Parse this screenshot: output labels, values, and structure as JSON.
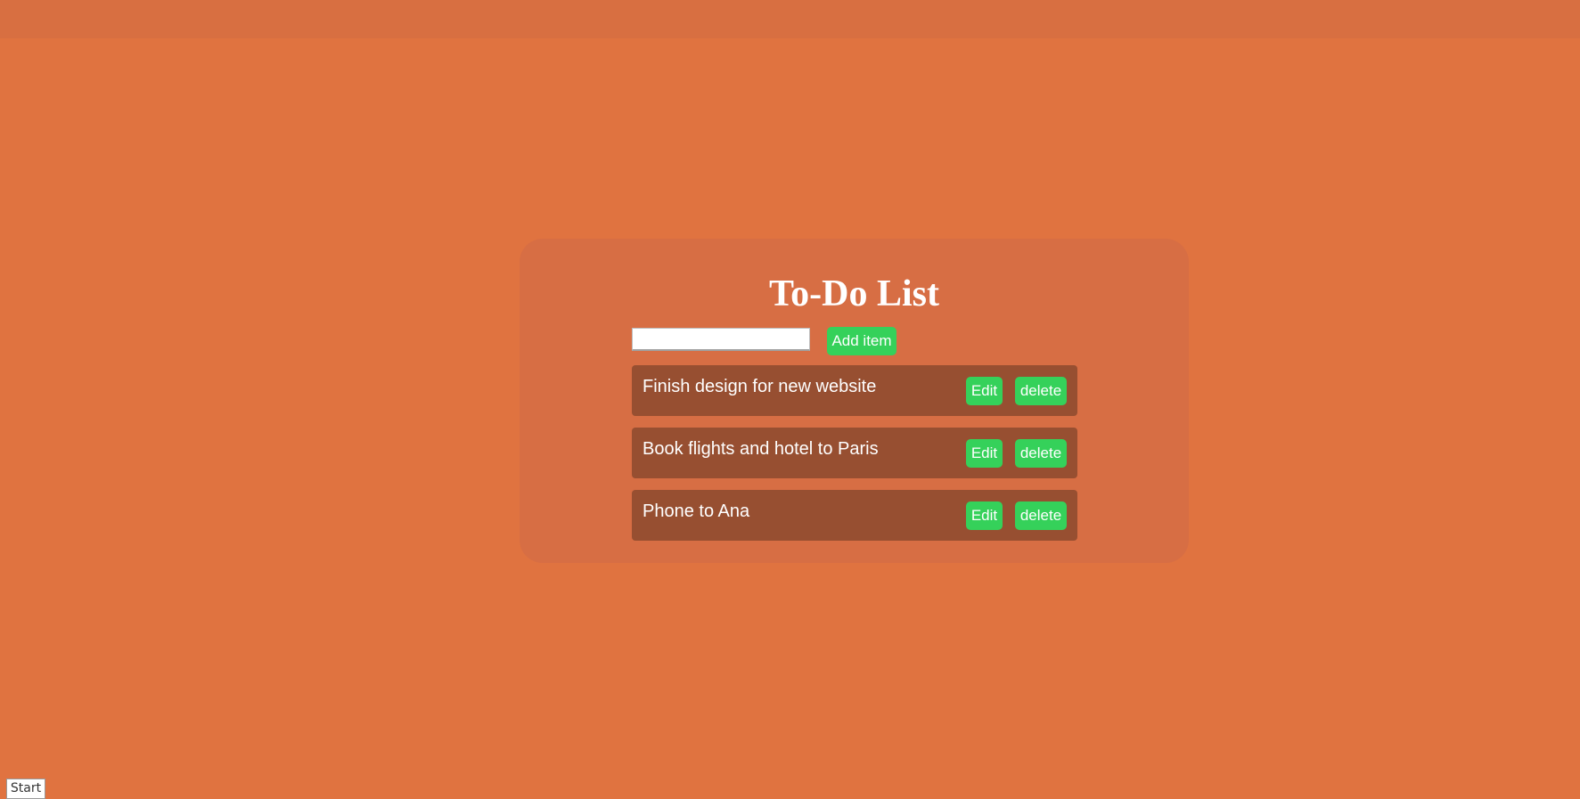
{
  "colors": {
    "background": "#e07340",
    "top_bar": "#d86f41",
    "card": "#d76e44",
    "item_background": "#974f31",
    "button": "#35d15a",
    "text": "#ffffff"
  },
  "todo": {
    "title": "To-Do List",
    "input": {
      "value": "",
      "placeholder": ""
    },
    "add_label": "Add item",
    "items": [
      {
        "text": "Finish design for new website",
        "edit_label": "Edit",
        "delete_label": "delete"
      },
      {
        "text": "Book flights and hotel to Paris",
        "edit_label": "Edit",
        "delete_label": "delete"
      },
      {
        "text": "Phone to Ana",
        "edit_label": "Edit",
        "delete_label": "delete"
      }
    ]
  },
  "taskbar": {
    "start_label": "Start"
  }
}
